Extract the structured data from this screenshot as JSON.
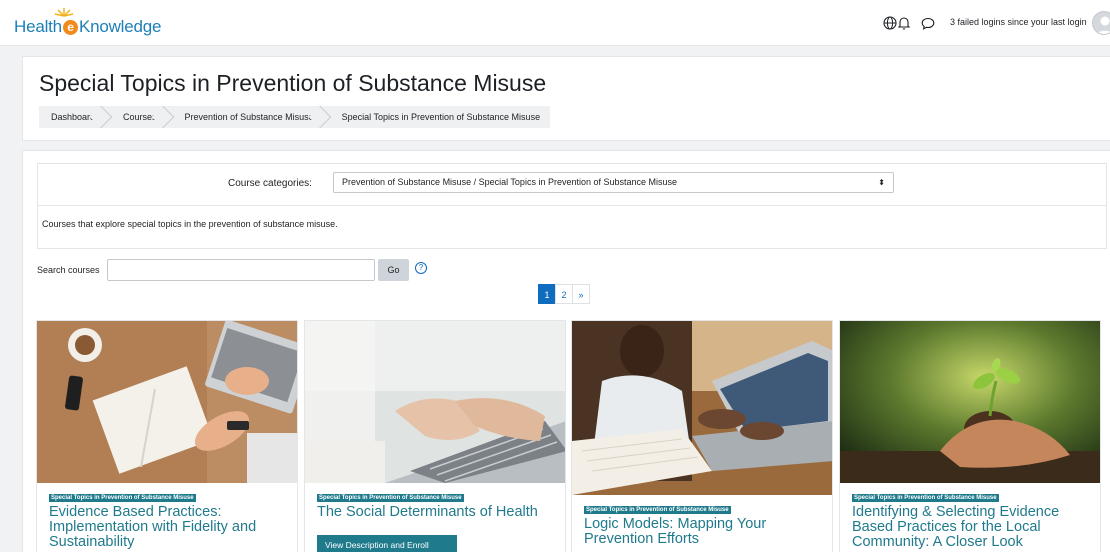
{
  "brand": {
    "part1": "Health",
    "part2": "e",
    "part3": "Knowledge"
  },
  "navbar": {
    "failed_logins": "3 failed logins since your last login"
  },
  "page": {
    "title": "Special Topics in Prevention of Substance Misuse"
  },
  "breadcrumb": [
    "Dashboard",
    "Courses",
    "Prevention of Substance Misuse",
    "Special Topics in Prevention of Substance Misuse"
  ],
  "filters": {
    "category_label": "Course categories:",
    "category_value": "Prevention of Substance Misuse / Special Topics in Prevention of Substance Misuse",
    "description": "Courses that explore special topics in the prevention of substance misuse.",
    "search_label": "Search courses",
    "search_value": "",
    "go_label": "Go"
  },
  "pagination": {
    "pages": [
      "1",
      "2",
      "»"
    ],
    "current": "1"
  },
  "courses": [
    {
      "category": "Special Topics in Prevention of Substance Misuse",
      "title": "Evidence Based Practices: Implementation with Fidelity and Sustainability"
    },
    {
      "category": "Special Topics in Prevention of Substance Misuse",
      "title": "The Social Determinants of Health",
      "button": "View Description and Enroll"
    },
    {
      "category": "Special Topics in Prevention of Substance Misuse",
      "title": "Logic Models: Mapping Your Prevention Efforts"
    },
    {
      "category": "Special Topics in Prevention of Substance Misuse",
      "title": "Identifying & Selecting Evidence Based Practices for the Local Community: A Closer Look"
    }
  ],
  "colors": {
    "accent": "#1f7a8c",
    "link": "#0f6cbf",
    "brand_blue": "#1e7fb8",
    "brand_orange": "#f28a1b"
  },
  "icons": [
    "globe-icon",
    "bell-icon",
    "chat-icon",
    "help-icon"
  ]
}
